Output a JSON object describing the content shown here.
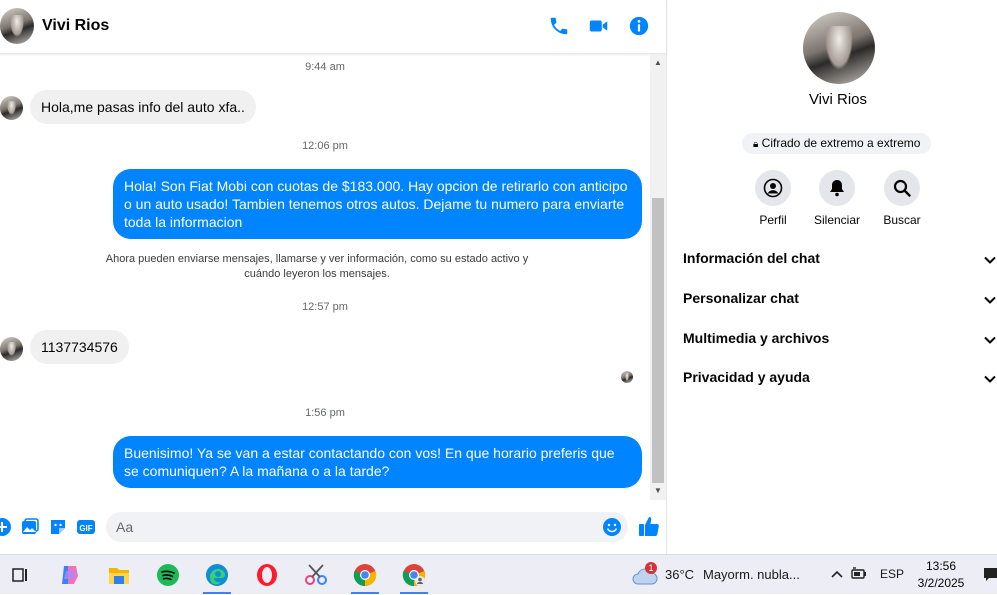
{
  "header": {
    "contact_name": "Vivi Rios"
  },
  "messages": [
    {
      "kind": "timestamp",
      "text": "9:44 am"
    },
    {
      "kind": "incoming",
      "text": "Hola,me pasas info del auto xfa.."
    },
    {
      "kind": "timestamp",
      "text": "12:06 pm"
    },
    {
      "kind": "outgoing",
      "text": "Hola! Son Fiat Mobi con cuotas de $183.000. Hay opcion de retirarlo con anticipo o un auto usado! Tambien tenemos otros autos. Dejame tu numero para enviarte toda la informacion"
    },
    {
      "kind": "notice",
      "text": "Ahora pueden enviarse mensajes, llamarse y ver información, como su estado activo y cuándo leyeron los mensajes."
    },
    {
      "kind": "timestamp",
      "text": "12:57 pm"
    },
    {
      "kind": "incoming",
      "text": "1137734576"
    },
    {
      "kind": "timestamp",
      "text": "1:56 pm"
    },
    {
      "kind": "outgoing",
      "text": "Buenisimo! Ya se van a estar contactando con vos! En que horario preferis que se comuniquen? A la mañana o a la tarde?"
    }
  ],
  "composer": {
    "placeholder": "Aa"
  },
  "info_panel": {
    "name": "Vivi Rios",
    "encryption_badge": "Cifrado de extremo a extremo",
    "actions": [
      {
        "label": "Perfil",
        "icon": "profile-icon"
      },
      {
        "label": "Silenciar",
        "icon": "bell-icon"
      },
      {
        "label": "Buscar",
        "icon": "search-icon"
      }
    ],
    "sections": [
      "Información del chat",
      "Personalizar chat",
      "Multimedia y archivos",
      "Privacidad y ayuda"
    ]
  },
  "taskbar": {
    "weather_temp": "36°C",
    "weather_desc": "Mayorm. nubla...",
    "weather_badge": "1",
    "language": "ESP",
    "time": "13:56",
    "date": "3/2/2025"
  },
  "colors": {
    "accent": "#0084ff",
    "incoming_bubble": "#f0f0f0"
  }
}
